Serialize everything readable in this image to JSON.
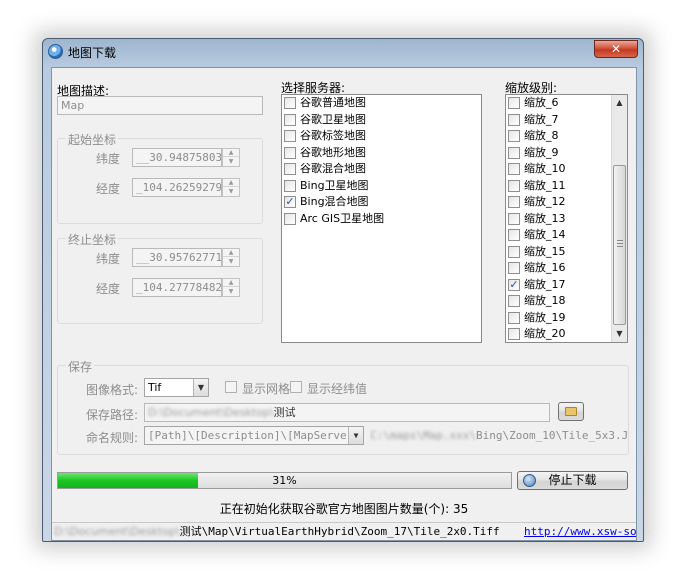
{
  "window": {
    "title": "地图下载",
    "close_label": "✕"
  },
  "map_description": {
    "label": "地图描述:",
    "value": "Map"
  },
  "start_coords": {
    "title": "起始坐标",
    "lat_label": "纬度",
    "lat_value": "__30.94875803",
    "lng_label": "经度",
    "lng_value": "_104.26259279"
  },
  "end_coords": {
    "title": "终止坐标",
    "lat_label": "纬度",
    "lat_value": "__30.95762771",
    "lng_label": "经度",
    "lng_value": "_104.27778482"
  },
  "servers": {
    "label": "选择服务器:",
    "items": [
      {
        "label": "谷歌普通地图",
        "checked": false
      },
      {
        "label": "谷歌卫星地图",
        "checked": false
      },
      {
        "label": "谷歌标签地图",
        "checked": false
      },
      {
        "label": "谷歌地形地图",
        "checked": false
      },
      {
        "label": "谷歌混合地图",
        "checked": false
      },
      {
        "label": "Bing卫星地图",
        "checked": false
      },
      {
        "label": "Bing混合地图",
        "checked": true
      },
      {
        "label": "Arc GIS卫星地图",
        "checked": false
      }
    ]
  },
  "zoom": {
    "label": "缩放级别:",
    "items": [
      {
        "label": "缩放_6",
        "checked": false
      },
      {
        "label": "缩放_7",
        "checked": false
      },
      {
        "label": "缩放_8",
        "checked": false
      },
      {
        "label": "缩放_9",
        "checked": false
      },
      {
        "label": "缩放_10",
        "checked": false
      },
      {
        "label": "缩放_11",
        "checked": false
      },
      {
        "label": "缩放_12",
        "checked": false
      },
      {
        "label": "缩放_13",
        "checked": false
      },
      {
        "label": "缩放_14",
        "checked": false
      },
      {
        "label": "缩放_15",
        "checked": false
      },
      {
        "label": "缩放_16",
        "checked": false
      },
      {
        "label": "缩放_17",
        "checked": true
      },
      {
        "label": "缩放_18",
        "checked": false
      },
      {
        "label": "缩放_19",
        "checked": false
      },
      {
        "label": "缩放_20",
        "checked": false
      }
    ]
  },
  "save": {
    "title": "保存",
    "format_label": "图像格式:",
    "format_value": "Tif",
    "show_grid_label": "显示网格",
    "show_coords_label": "显示经纬值",
    "path_label": "保存路径:",
    "path_prefix": "D:\\Document\\Desktop\\",
    "path_value": "测试",
    "naming_label": "命名规则:",
    "naming_value": "[Path]\\[Description]\\[MapServe",
    "naming_preview_prefix": "C:\\maps\\Map.xxx\\",
    "naming_preview": "Bing\\Zoom_10\\Tile_5x3.J"
  },
  "progress": {
    "percent_text": "31%",
    "fraction": 0.31
  },
  "stop_button_label": "停止下载",
  "status_message": "正在初始化获取谷歌官方地图图片数量(个): 35",
  "statusbar": {
    "path_prefix": "D:\\Document\\Desktop\\",
    "path": "测试\\Map\\VirtualEarthHybrid\\Zoom_17\\Tile_2x0.Tiff",
    "link": "http://www.xsw-sof"
  }
}
